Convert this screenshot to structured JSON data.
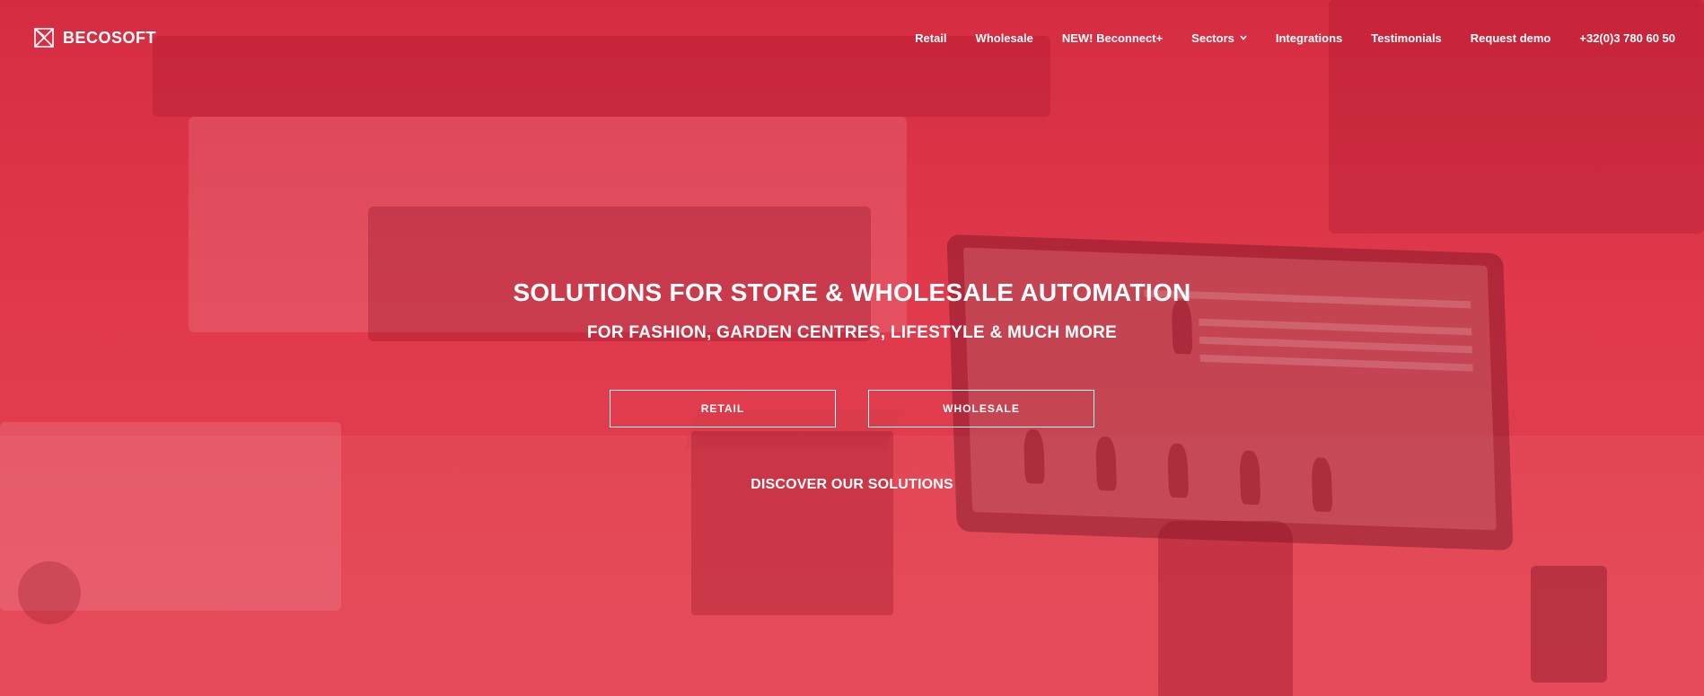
{
  "brand": {
    "name": "BECOSOFT"
  },
  "nav": {
    "items": [
      {
        "label": "Retail"
      },
      {
        "label": "Wholesale"
      },
      {
        "label": "NEW! Beconnect+"
      },
      {
        "label": "Sectors",
        "has_dropdown": true
      },
      {
        "label": "Integrations"
      },
      {
        "label": "Testimonials"
      },
      {
        "label": "Request demo"
      },
      {
        "label": "+32(0)3 780 60 50"
      }
    ]
  },
  "hero": {
    "title": "SOLUTIONS FOR STORE & WHOLESALE AUTOMATION",
    "subtitle": "FOR FASHION, GARDEN CENTRES, LIFESTYLE & MUCH MORE",
    "buttons": {
      "retail": "RETAIL",
      "wholesale": "WHOLESALE"
    },
    "discover": "DISCOVER OUR SOLUTIONS"
  },
  "colors": {
    "overlay": "#e03a4c",
    "text": "#ffffff"
  },
  "icons": {
    "logo": "envelope-cross-logo-icon",
    "dropdown": "chevron-down-icon"
  }
}
